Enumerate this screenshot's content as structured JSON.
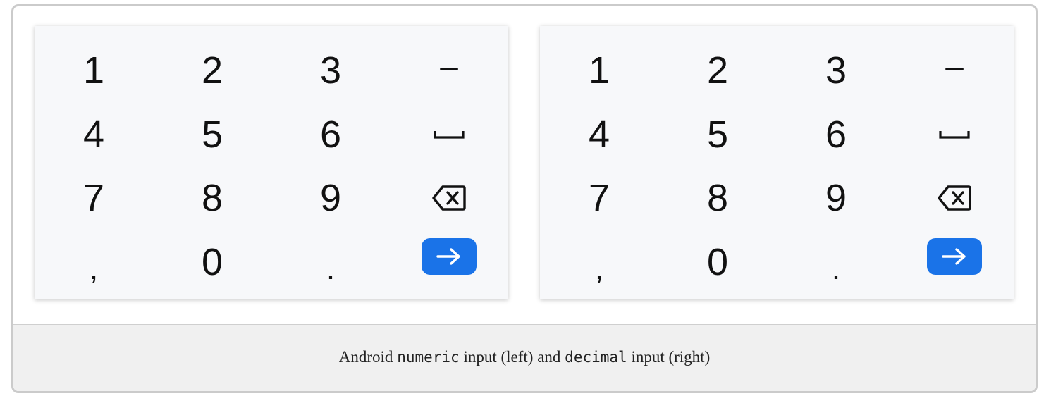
{
  "keyboards": [
    {
      "id": "numeric",
      "rows": [
        [
          "1",
          "2",
          "3",
          "–"
        ],
        [
          "4",
          "5",
          "6",
          "space"
        ],
        [
          "7",
          "8",
          "9",
          "backspace"
        ],
        [
          ",",
          "0",
          ".",
          "enter"
        ]
      ]
    },
    {
      "id": "decimal",
      "rows": [
        [
          "1",
          "2",
          "3",
          "–"
        ],
        [
          "4",
          "5",
          "6",
          "space"
        ],
        [
          "7",
          "8",
          "9",
          "backspace"
        ],
        [
          ",",
          "0",
          ".",
          "enter"
        ]
      ]
    }
  ],
  "colors": {
    "enter_bg": "#1a73e8",
    "keyboard_bg": "#f7f8fa",
    "caption_bg": "#f0f0f0"
  },
  "icons": {
    "space": "space-bar-icon",
    "backspace": "backspace-icon",
    "enter": "arrow-right-icon"
  },
  "caption": {
    "prefix": "Android ",
    "code1": "numeric",
    "middle": " input (left) and ",
    "code2": "decimal",
    "suffix": " input (right)"
  }
}
